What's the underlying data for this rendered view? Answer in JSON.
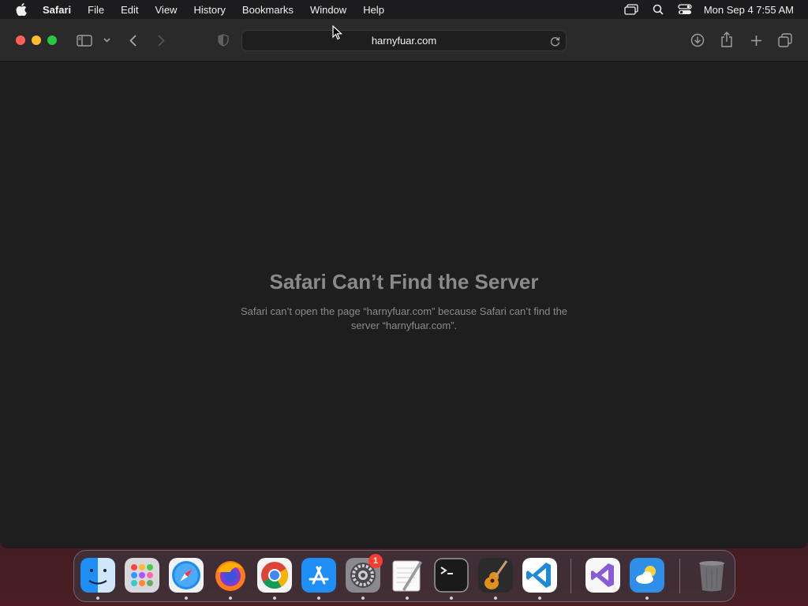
{
  "menubar": {
    "app_name": "Safari",
    "items": [
      "File",
      "Edit",
      "View",
      "History",
      "Bookmarks",
      "Window",
      "Help"
    ],
    "clock": "Mon Sep 4  7:55 AM"
  },
  "browser": {
    "url": "harnyfuar.com"
  },
  "error": {
    "title": "Safari Can’t Find the Server",
    "message": "Safari can’t open the page “harnyfuar.com” because Safari can’t find the server “harnyfuar.com”."
  },
  "dock": {
    "apps": [
      "finder-icon",
      "launchpad-icon",
      "safari-icon",
      "firefox-icon",
      "chrome-icon",
      "app-store-icon",
      "system-settings-icon",
      "textedit-icon",
      "terminal-icon",
      "garageband-icon",
      "vscode-icon",
      "visual-studio-icon",
      "weather-icon",
      "trash-icon"
    ],
    "settings_badge": "1"
  },
  "colors": {
    "close": "#ff5f57",
    "minimize": "#febc2e",
    "maximize": "#28c840",
    "badge": "#ff3b30"
  }
}
